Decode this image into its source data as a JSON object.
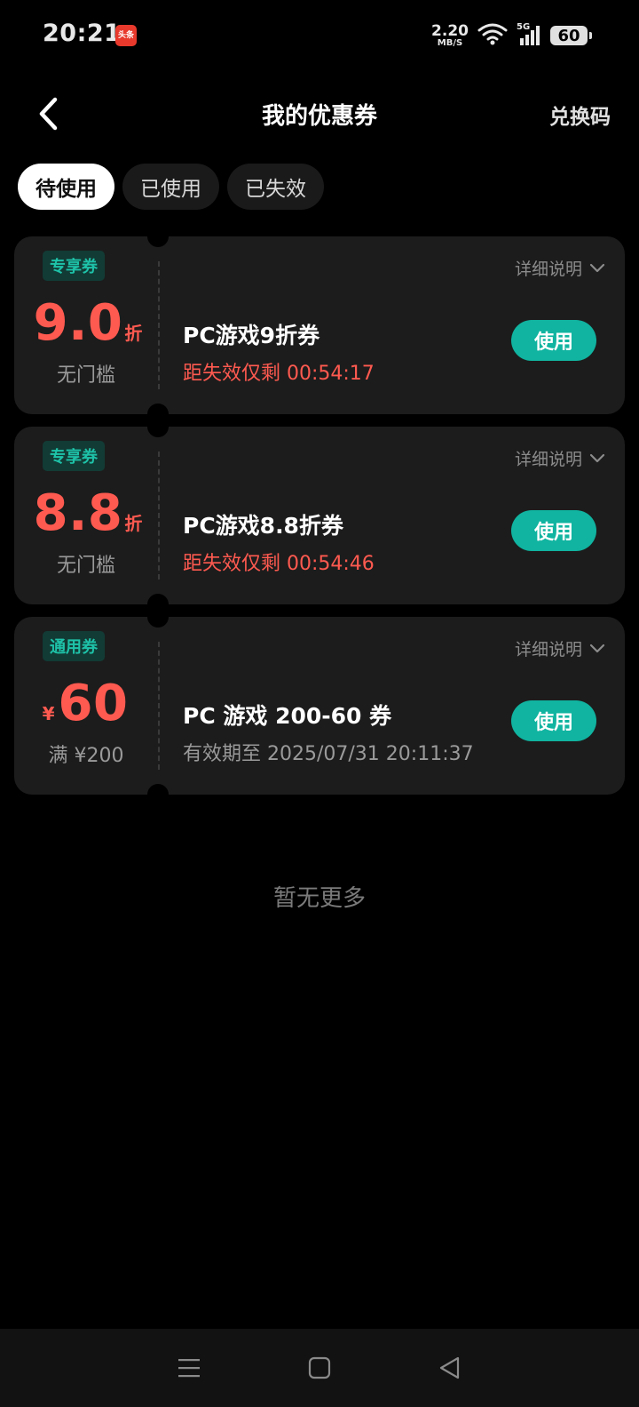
{
  "status_bar": {
    "time": "20:21",
    "app_badge": "头条",
    "net_speed_value": "2.20",
    "net_speed_unit": "MB/S",
    "network_type": "5G",
    "battery": "60",
    "icons": [
      "wifi-icon",
      "signal-icon",
      "battery-icon"
    ]
  },
  "header": {
    "title": "我的优惠券",
    "redeem_label": "兑换码",
    "back_icon": "chevron-left-icon"
  },
  "tabs": [
    {
      "label": "待使用",
      "active": true
    },
    {
      "label": "已使用",
      "active": false
    },
    {
      "label": "已失效",
      "active": false
    }
  ],
  "coupons": [
    {
      "tag": "专享券",
      "value": "9.0",
      "unit": "折",
      "prefix": "",
      "threshold": "无门槛",
      "detail_label": "详细说明",
      "title": "PC游戏9折券",
      "expiry": "距失效仅剩 00:54:17",
      "use_label": "使用"
    },
    {
      "tag": "专享券",
      "value": "8.8",
      "unit": "折",
      "prefix": "",
      "threshold": "无门槛",
      "detail_label": "详细说明",
      "title": "PC游戏8.8折券",
      "expiry": "距失效仅剩 00:54:46",
      "use_label": "使用"
    },
    {
      "tag": "通用券",
      "value": "60",
      "unit": "",
      "prefix": "¥",
      "threshold": "满 ¥200",
      "detail_label": "详细说明",
      "title": "PC 游戏 200-60 券",
      "expiry": "有效期至 2025/07/31 20:11:37",
      "use_label": "使用"
    }
  ],
  "footer_note": "暂无更多",
  "colors": {
    "accent": "#10b4a0",
    "price_red": "#ff5a50",
    "tag_text": "#1ec2a8",
    "card_bg": "#1c1c1c"
  },
  "nav_bar": {
    "icons": [
      "menu-icon",
      "home-square-icon",
      "back-triangle-icon"
    ]
  }
}
